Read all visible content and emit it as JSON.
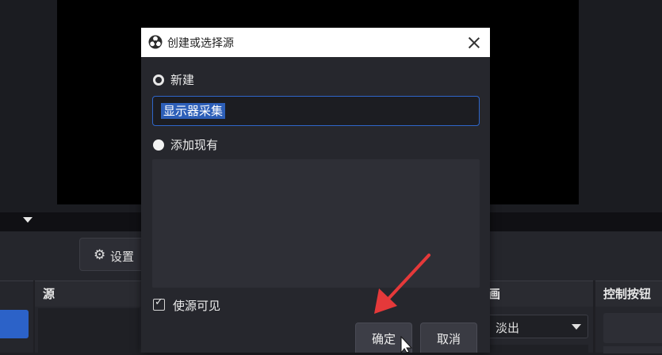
{
  "main_window": {
    "settings_label": "设置",
    "panels": {
      "sources_title": "源",
      "transition_title": "画",
      "transition_value": "淡出",
      "controls_title": "控制按钮"
    }
  },
  "dialog": {
    "title": "创建或选择源",
    "option_new_label": "新建",
    "name_value": "显示器采集",
    "option_existing_label": "添加现有",
    "visible_checkbox_label": "使源可见",
    "visible_checked": true,
    "ok_label": "确定",
    "cancel_label": "取消"
  },
  "colors": {
    "accent": "#2f66c9",
    "annotation_arrow": "#e5393a"
  },
  "icons": [
    "obs-logo-icon",
    "close-icon",
    "gear-icon",
    "chevron-down-icon",
    "check-icon",
    "mouse-cursor-icon",
    "red-annotation-arrow"
  ]
}
